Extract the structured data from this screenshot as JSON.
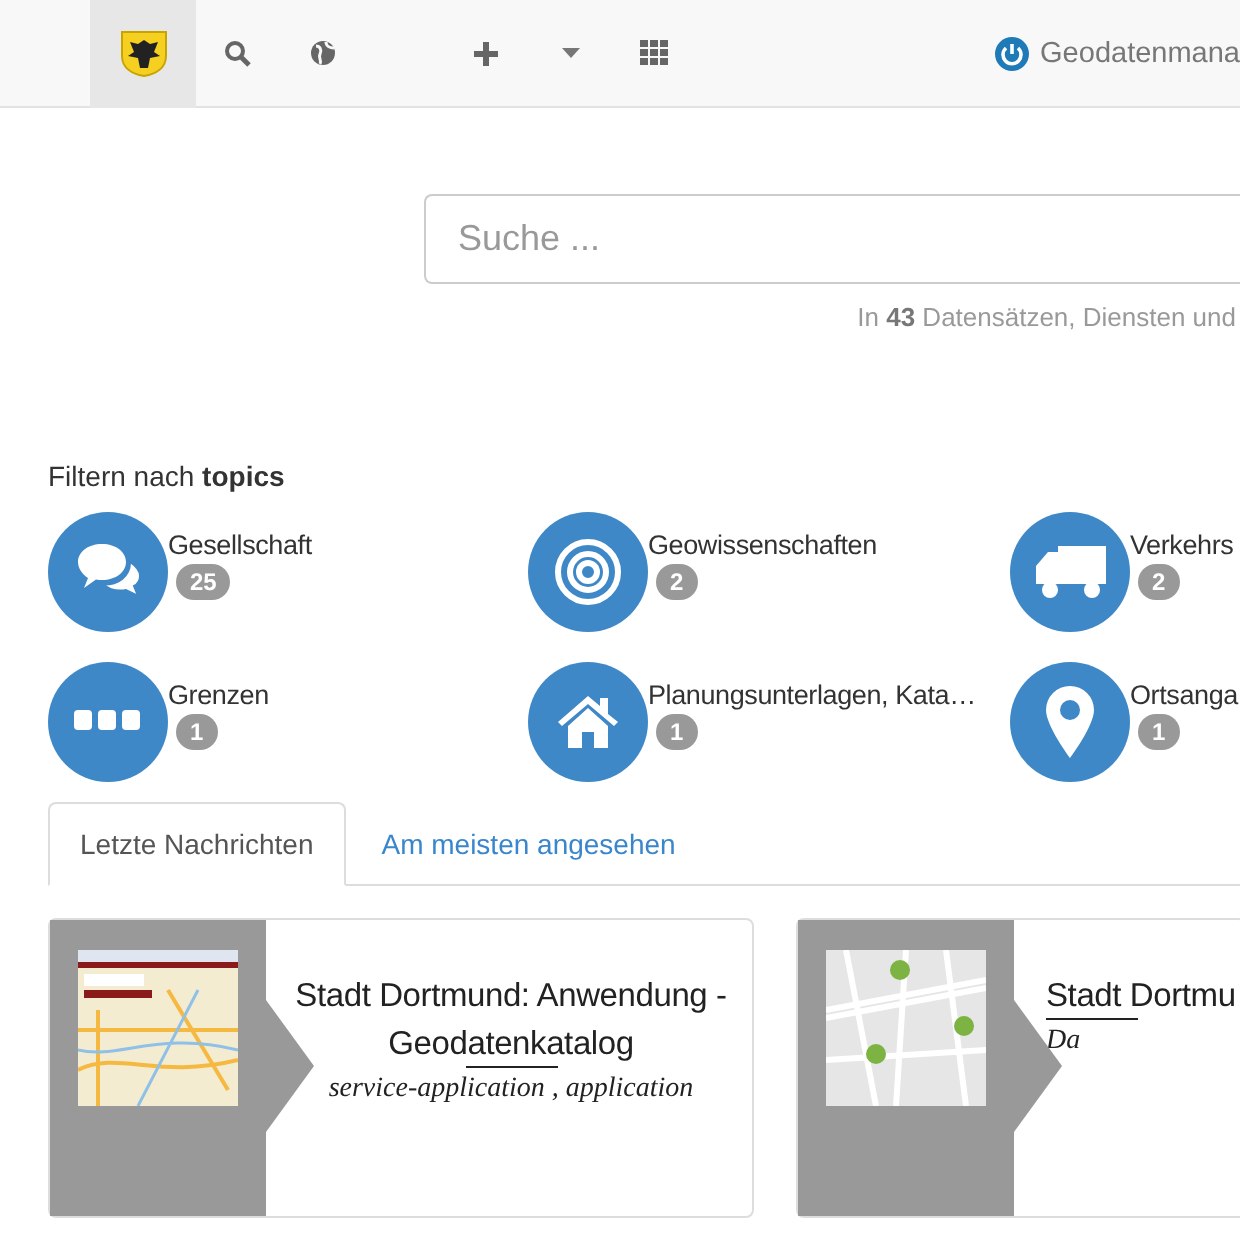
{
  "navbar": {
    "user": "Geodatenmana"
  },
  "search": {
    "placeholder": "Suche ...",
    "summary": "In **43** Datensätzen, Diensten und"
  },
  "topics": {
    "heading": "Filtern nach **topics**",
    "items": [
      {
        "kind": "chat",
        "name": "Gesellschaft",
        "count": "25"
      },
      {
        "kind": "target",
        "name": "Geowissenschaften",
        "count": "2"
      },
      {
        "kind": "truck",
        "name": "Verkehrs",
        "count": "2"
      },
      {
        "kind": "dots",
        "name": "Grenzen",
        "count": "1"
      },
      {
        "kind": "house",
        "name": "Planungsunterlagen, Kata…",
        "count": "1"
      },
      {
        "kind": "pin",
        "name": "Ortsanga",
        "count": "1"
      }
    ]
  },
  "tabs": [
    {
      "label": "Letzte Nachrichten",
      "selected": true
    },
    {
      "label": "Am meisten angesehen",
      "selected": false
    }
  ],
  "cards": [
    {
      "kind": "app",
      "title": "Stadt Dortmund: Anwendung - Geodatenkatalog",
      "subtitle": "service-application , application"
    },
    {
      "kind": "map",
      "title": "Stadt Dortmu",
      "subtitle": "Da"
    }
  ]
}
